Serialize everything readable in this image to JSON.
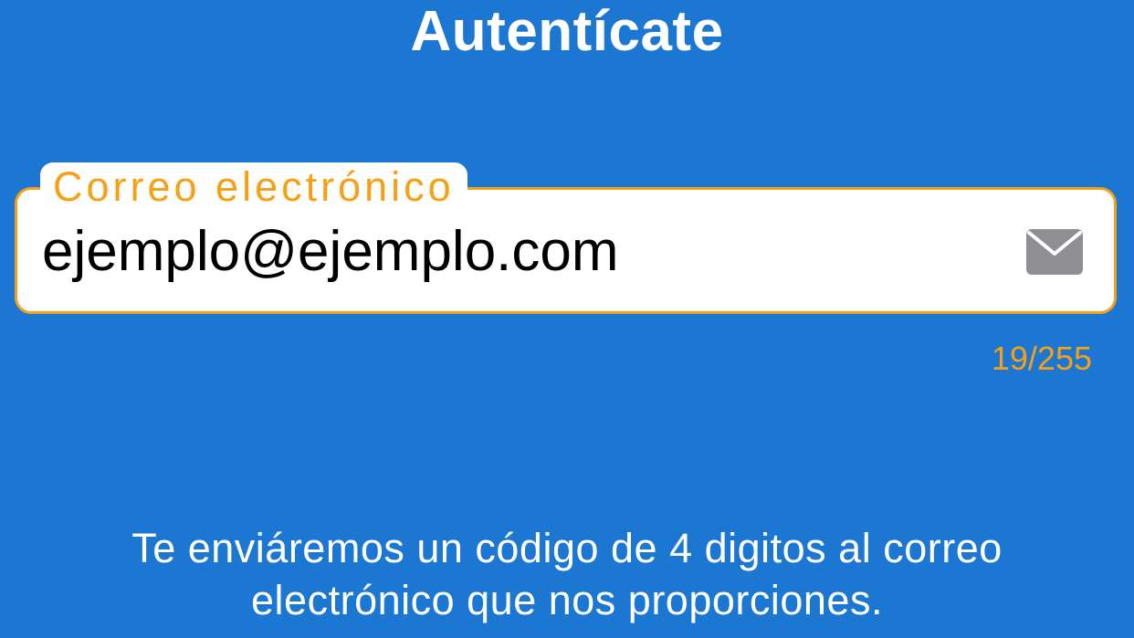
{
  "header": {
    "title": "Autentícate"
  },
  "email_field": {
    "label": "Correo electrónico",
    "value": "ejemplo@ejemplo.com",
    "icon": "envelope-icon",
    "counter": "19/255"
  },
  "info": {
    "line1": "Te enviáremos un código de 4 digitos al correo",
    "line2": "electrónico que nos proporciones."
  },
  "colors": {
    "background": "#1b77d2",
    "accent": "#f5a017",
    "field_background": "#ffffff",
    "icon": "#8e8e93"
  }
}
